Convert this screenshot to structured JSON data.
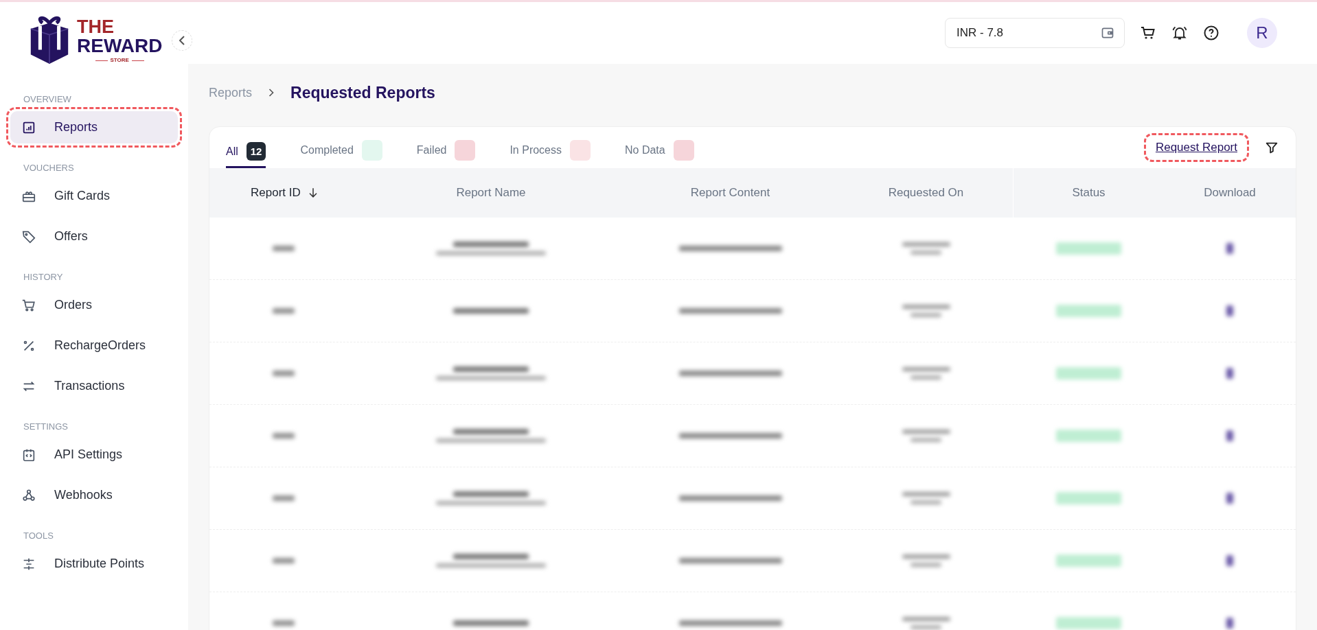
{
  "logo": {
    "line1": "THE",
    "line2": "REWARD",
    "line3": "STORE"
  },
  "header": {
    "balance": "INR - 7.8",
    "avatar": "R"
  },
  "sidebar": {
    "sections": [
      {
        "title": "OVERVIEW",
        "items": [
          {
            "label": "Reports",
            "kind": "chart",
            "selected": true,
            "highlighted": true
          }
        ]
      },
      {
        "title": "VOUCHERS",
        "items": [
          {
            "label": "Gift Cards",
            "kind": "gift",
            "selected": false,
            "highlighted": false
          },
          {
            "label": "Offers",
            "kind": "tag",
            "selected": false,
            "highlighted": false
          }
        ]
      },
      {
        "title": "HISTORY",
        "items": [
          {
            "label": "Orders",
            "kind": "cart",
            "selected": false,
            "highlighted": false
          },
          {
            "label": "RechargeOrders",
            "kind": "percent",
            "selected": false,
            "highlighted": false
          },
          {
            "label": "Transactions",
            "kind": "swap",
            "selected": false,
            "highlighted": false
          }
        ]
      },
      {
        "title": "SETTINGS",
        "items": [
          {
            "label": "API Settings",
            "kind": "code",
            "selected": false,
            "highlighted": false
          },
          {
            "label": "Webhooks",
            "kind": "webhook",
            "selected": false,
            "highlighted": false
          }
        ]
      },
      {
        "title": "TOOLS",
        "items": [
          {
            "label": "Distribute Points",
            "kind": "distribute",
            "selected": false,
            "highlighted": false
          }
        ]
      }
    ]
  },
  "breadcrumb": {
    "parent": "Reports",
    "current": "Requested Reports"
  },
  "tabs": [
    {
      "label": "All",
      "count": "12",
      "selected": true
    },
    {
      "label": "Completed",
      "color": "#e3f7ef",
      "selected": false
    },
    {
      "label": "Failed",
      "color": "#f6d5da",
      "selected": false
    },
    {
      "label": "In Process",
      "color": "#fae3e5",
      "selected": false
    },
    {
      "label": "No Data",
      "color": "#f6d5da",
      "selected": false
    }
  ],
  "request_link": {
    "label": "Request Report",
    "highlighted": true
  },
  "table": {
    "columns": [
      {
        "label": "Report ID",
        "sorted": true
      },
      {
        "label": "Report Name",
        "sorted": false
      },
      {
        "label": "Report Content",
        "sorted": false
      },
      {
        "label": "Requested On",
        "sorted": false
      },
      {
        "label": "Status",
        "sorted": false
      },
      {
        "label": "Download",
        "sorted": false
      }
    ],
    "rows": [
      {
        "kind": "two-line"
      },
      {
        "kind": "one-line"
      },
      {
        "kind": "two-line"
      },
      {
        "kind": "two-line"
      },
      {
        "kind": "two-line"
      },
      {
        "kind": "two-line"
      },
      {
        "kind": "one-line"
      }
    ]
  }
}
